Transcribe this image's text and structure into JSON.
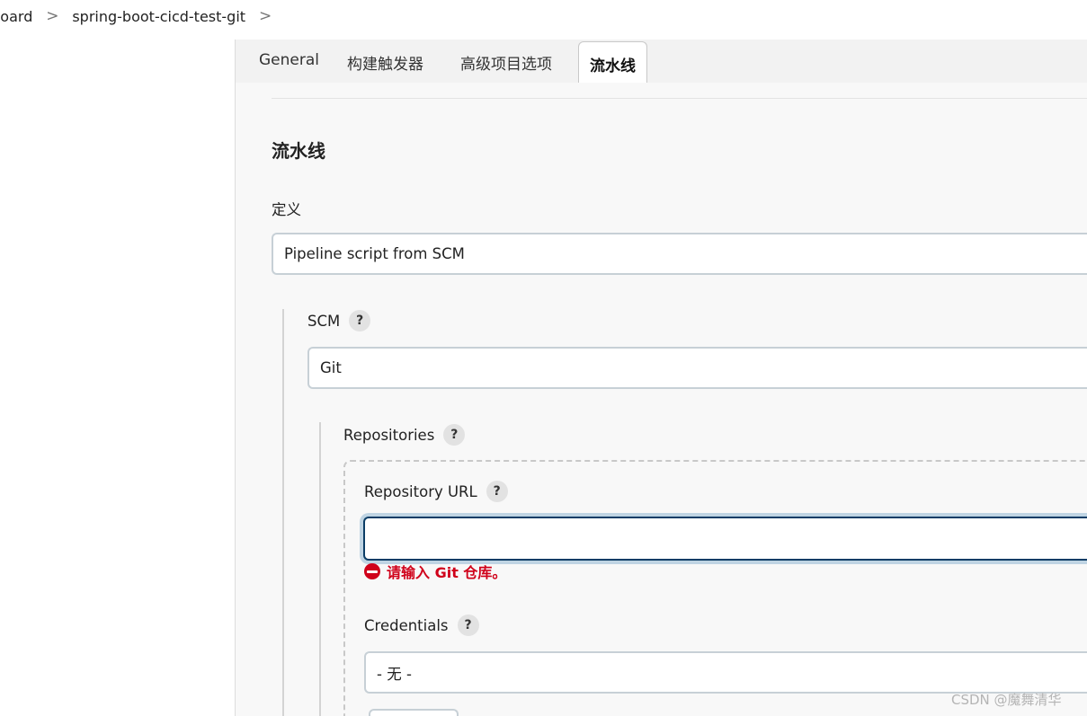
{
  "breadcrumb": {
    "items": [
      "hboard",
      "spring-boot-cicd-test-git"
    ],
    "separator": ">"
  },
  "tabs": [
    {
      "label": "General",
      "active": false
    },
    {
      "label": "构建触发器",
      "active": false
    },
    {
      "label": "高级项目选项",
      "active": false
    },
    {
      "label": "流水线",
      "active": true
    }
  ],
  "pipeline": {
    "title": "流水线",
    "definition_label": "定义",
    "definition_value": "Pipeline script from SCM",
    "scm": {
      "label": "SCM",
      "value": "Git",
      "repositories_label": "Repositories",
      "repository_url_label": "Repository URL",
      "repository_url_value": "",
      "error_message": "请输入 Git 仓库。",
      "credentials_label": "Credentials",
      "credentials_value": "- 无 -"
    },
    "help_glyph": "?"
  },
  "watermark": "CSDN @魔舞清华",
  "colors": {
    "error": "#d0021b",
    "focus_border": "#0b3d66",
    "focus_ring": "#bfd4e3",
    "tabbar_bg": "#f2f2f2"
  },
  "icons": {
    "breadcrumb_separator": "chevron-right-icon",
    "help": "question-mark-icon",
    "error": "no-entry-icon"
  }
}
